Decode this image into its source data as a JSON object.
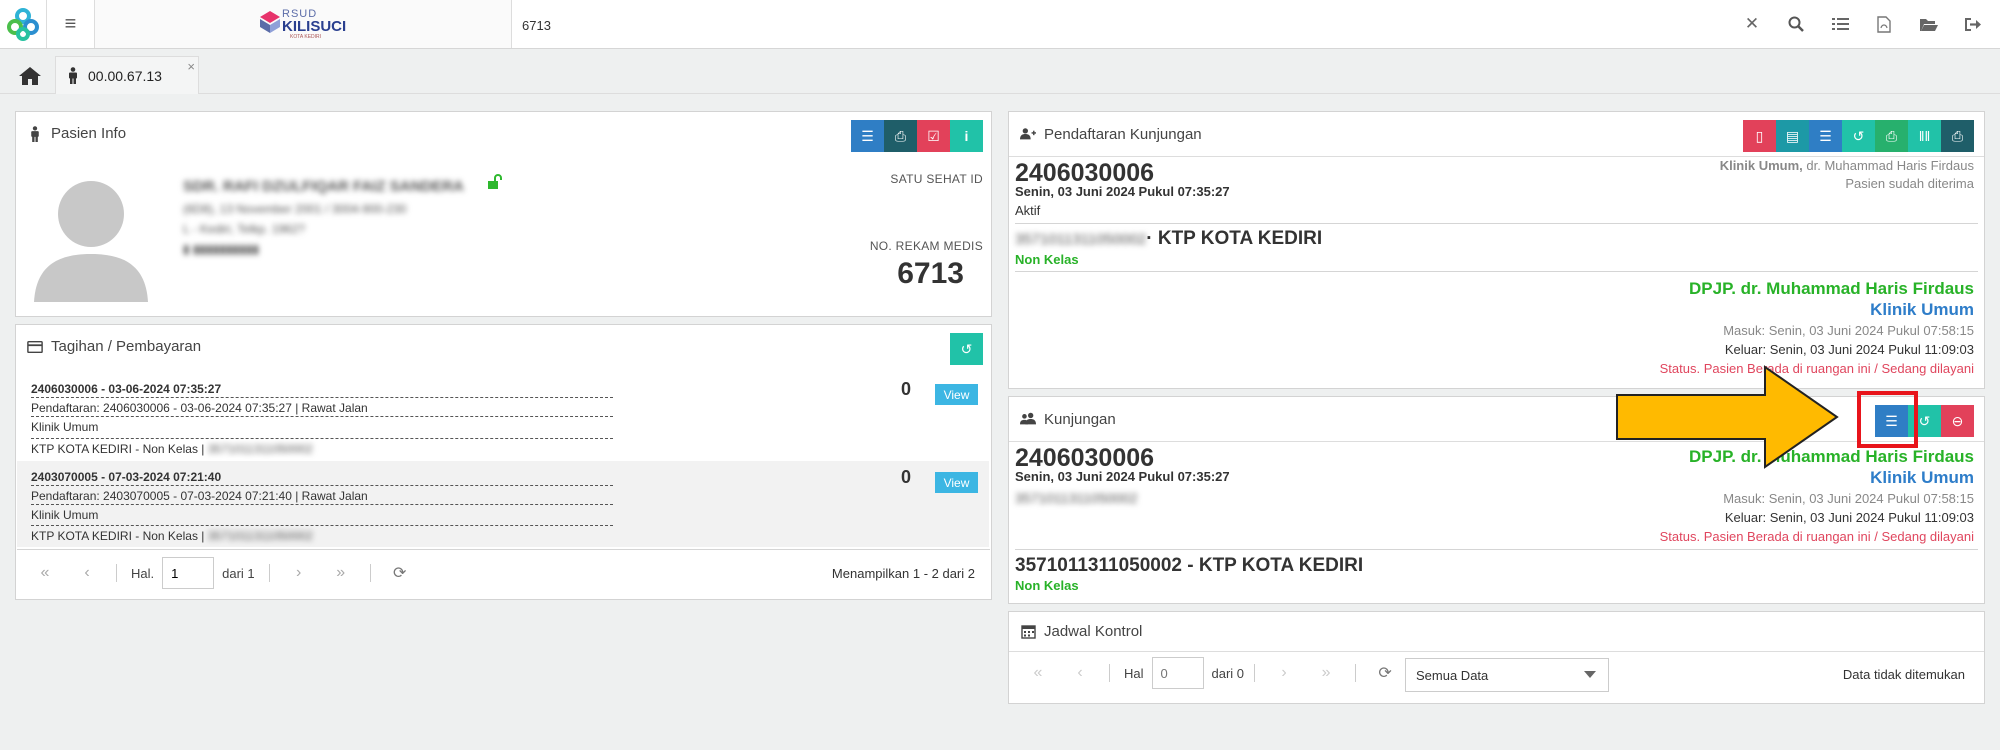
{
  "topbar": {
    "search_value": "6713",
    "brand_line1": "RSUD",
    "brand_line2": "KILISUCI",
    "brand_line3": "KOTA KEDIRI",
    "icons": [
      "close-icon",
      "search-icon",
      "list-icon",
      "pdf-icon",
      "folder-open-icon",
      "logout-icon"
    ]
  },
  "tabs": {
    "patient_tab_label": "00.00.67.13",
    "close_glyph": "×"
  },
  "pasien_info": {
    "title": "Pasien Info",
    "name": "SDR. RAFI DZULFIQAR FAIZ SANDERA",
    "line1": "(6D8), 13 November 2001 / 3004-900-230",
    "line2": "L - Kediri, Telkp. 1962?",
    "line3": "▮ ▮▮▮▮▮▮▮▮▮▮",
    "satu_sehat_label": "SATU SEHAT ID",
    "no_rm_label": "NO. REKAM MEDIS",
    "no_rm_value": "6713"
  },
  "tagihan": {
    "title": "Tagihan / Pembayaran",
    "rows": [
      {
        "header": "2406030006 - 03-06-2024 07:35:27",
        "pendaftaran": "Pendaftaran: 2406030006 - 03-06-2024 07:35:27 | Rawat Jalan",
        "klinik": "Klinik Umum",
        "ktp": "KTP KOTA KEDIRI - Non Kelas |",
        "ktp_blur": "3571011311050002",
        "amount": "0",
        "view_label": "View"
      },
      {
        "header": "2403070005 - 07-03-2024 07:21:40",
        "pendaftaran": "Pendaftaran: 2403070005 - 07-03-2024 07:21:40 | Rawat Jalan",
        "klinik": "Klinik Umum",
        "ktp": "KTP KOTA KEDIRI - Non Kelas |",
        "ktp_blur": "3571011311050002",
        "amount": "0",
        "view_label": "View"
      }
    ],
    "pager": {
      "hal_label": "Hal.",
      "page_value": "1",
      "dari_label": "dari 1",
      "summary": "Menampilkan 1 - 2 dari 2"
    }
  },
  "pendaftaran": {
    "title": "Pendaftaran Kunjungan",
    "number": "2406030006",
    "date": "Senin, 03 Juni 2024 Pukul 07:35:27",
    "status": "Aktif",
    "clinic_line_bold": "Klinik Umum,",
    "clinic_line_rest": " dr. Muhammad Haris Firdaus",
    "accepted": "Pasien sudah diterima",
    "ktp_blur": "3571011311050002",
    "ktp_label": "· KTP KOTA KEDIRI",
    "kelas": "Non Kelas",
    "dpjp": "DPJP. dr. Muhammad Haris Firdaus",
    "klinik": "Klinik Umum",
    "masuk": "Masuk: Senin, 03 Juni 2024 Pukul 07:58:15",
    "keluar": "Keluar: Senin, 03 Juni 2024 Pukul 11:09:03",
    "status_pasien": "Status. Pasien Berada di ruangan ini / Sedang dilayani"
  },
  "kunjungan": {
    "title": "Kunjungan",
    "number": "2406030006",
    "date": "Senin, 03 Juni 2024 Pukul 07:35:27",
    "ktp_blur": "3571011311050002",
    "dpjp": "DPJP. dr. Muhammad Haris Firdaus",
    "klinik": "Klinik Umum",
    "masuk": "Masuk: Senin, 03 Juni 2024 Pukul 07:58:15",
    "keluar": "Keluar: Senin, 03 Juni 2024 Pukul 11:09:03",
    "status_pasien": "Status. Pasien Berada di ruangan ini / Sedang dilayani",
    "ktp_full": "3571011311050002 - KTP KOTA KEDIRI",
    "kelas": "Non Kelas"
  },
  "jadwal": {
    "title": "Jadwal Kontrol",
    "hal_label": "Hal",
    "page_placeholder": "0",
    "dari_label": "dari 0",
    "filter_value": "Semua Data",
    "empty": "Data tidak ditemukan"
  },
  "colors": {
    "blue": "#2f7ec5",
    "dark": "#1f5e69",
    "red": "#e2415a",
    "teal": "#21c2a8",
    "green": "#27b06d",
    "accent_green": "#28b228",
    "accent_blue": "#2e7dc9",
    "annotation_arrow": "#ffba00",
    "annotation_box": "#e8141b"
  }
}
